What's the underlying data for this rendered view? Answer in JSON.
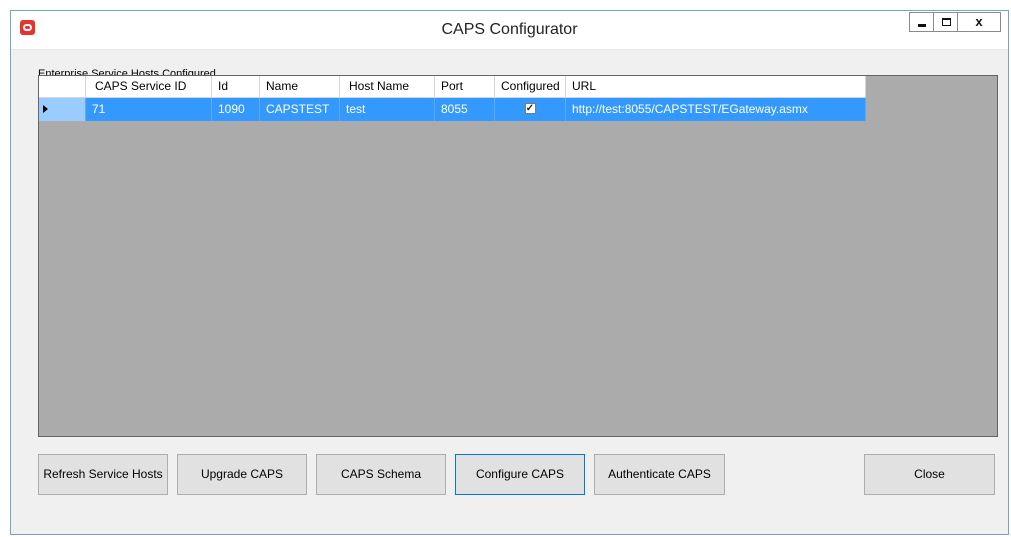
{
  "window": {
    "title": "CAPS Configurator",
    "close_glyph": "x"
  },
  "group_label": "Enterprise Service Hosts Configured",
  "grid": {
    "columns": [
      "CAPS Service ID",
      "Id",
      "Name",
      "Host Name",
      "Port",
      "Configured",
      "URL"
    ],
    "rows": [
      {
        "caps_service_id": "71",
        "id": "1090",
        "name": "CAPSTEST",
        "host_name": "test",
        "port": "8055",
        "configured": true,
        "url": "http://test:8055/CAPSTEST/EGateway.asmx"
      }
    ],
    "selected_row_color": "#3399ff",
    "background_color": "#ababab"
  },
  "buttons": {
    "refresh": "Refresh Service Hosts",
    "upgrade": "Upgrade CAPS",
    "schema": "CAPS Schema",
    "configure": "Configure CAPS",
    "authenticate": "Authenticate CAPS",
    "close": "Close"
  },
  "colors": {
    "logo": "#e8322e",
    "focus_border": "#0078d7"
  },
  "icons": {
    "app": "oracle-logo-icon",
    "row_indicator": "row-pointer-icon",
    "minimize": "minimize-icon",
    "maximize": "maximize-icon",
    "close": "close-icon"
  }
}
